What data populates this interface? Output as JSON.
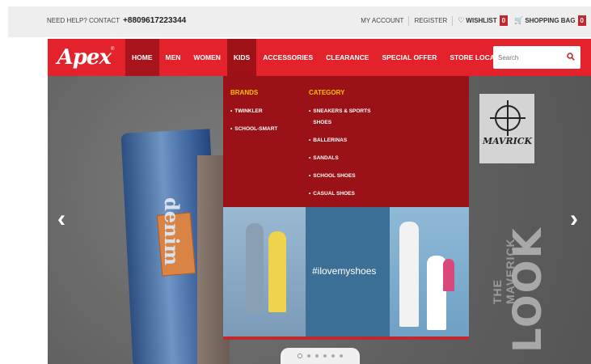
{
  "topbar": {
    "help_label": "NEED HELP? CONTACT",
    "phone": "+8809617223344",
    "my_account": "MY ACCOUNT",
    "register": "REGISTER",
    "wishlist_label": "WISHLIST",
    "wishlist_count": "0",
    "bag_label": "SHOPPING BAG",
    "bag_count": "0"
  },
  "nav": {
    "logo": "Apex",
    "items": [
      "HOME",
      "MEN",
      "WOMEN",
      "KIDS",
      "ACCESSORIES",
      "CLEARANCE",
      "SPECIAL OFFER",
      "STORE LOCATION"
    ],
    "search_placeholder": "Search"
  },
  "mega_menu": {
    "brands_title": "BRANDS",
    "brands": [
      "TWINKLER",
      "SCHOOL-SMART"
    ],
    "category_title": "CATEGORY",
    "categories": [
      "SNEAKERS & SPORTS SHOES",
      "BALLERINAS",
      "SANDALS",
      "SCHOOL SHOES",
      "CASUAL SHOES"
    ],
    "promo_tag": "#ilovemyshoes"
  },
  "hero": {
    "badge_text": "MAVRICK",
    "side_small": "THE MAVERICK",
    "side_big": "LOOK",
    "jeans_text": "denim",
    "prev": "‹",
    "next": "›"
  },
  "colors": {
    "brand_red": "#e3222b",
    "menu_dark": "#9a1217",
    "accent_yellow": "#f5c200"
  }
}
